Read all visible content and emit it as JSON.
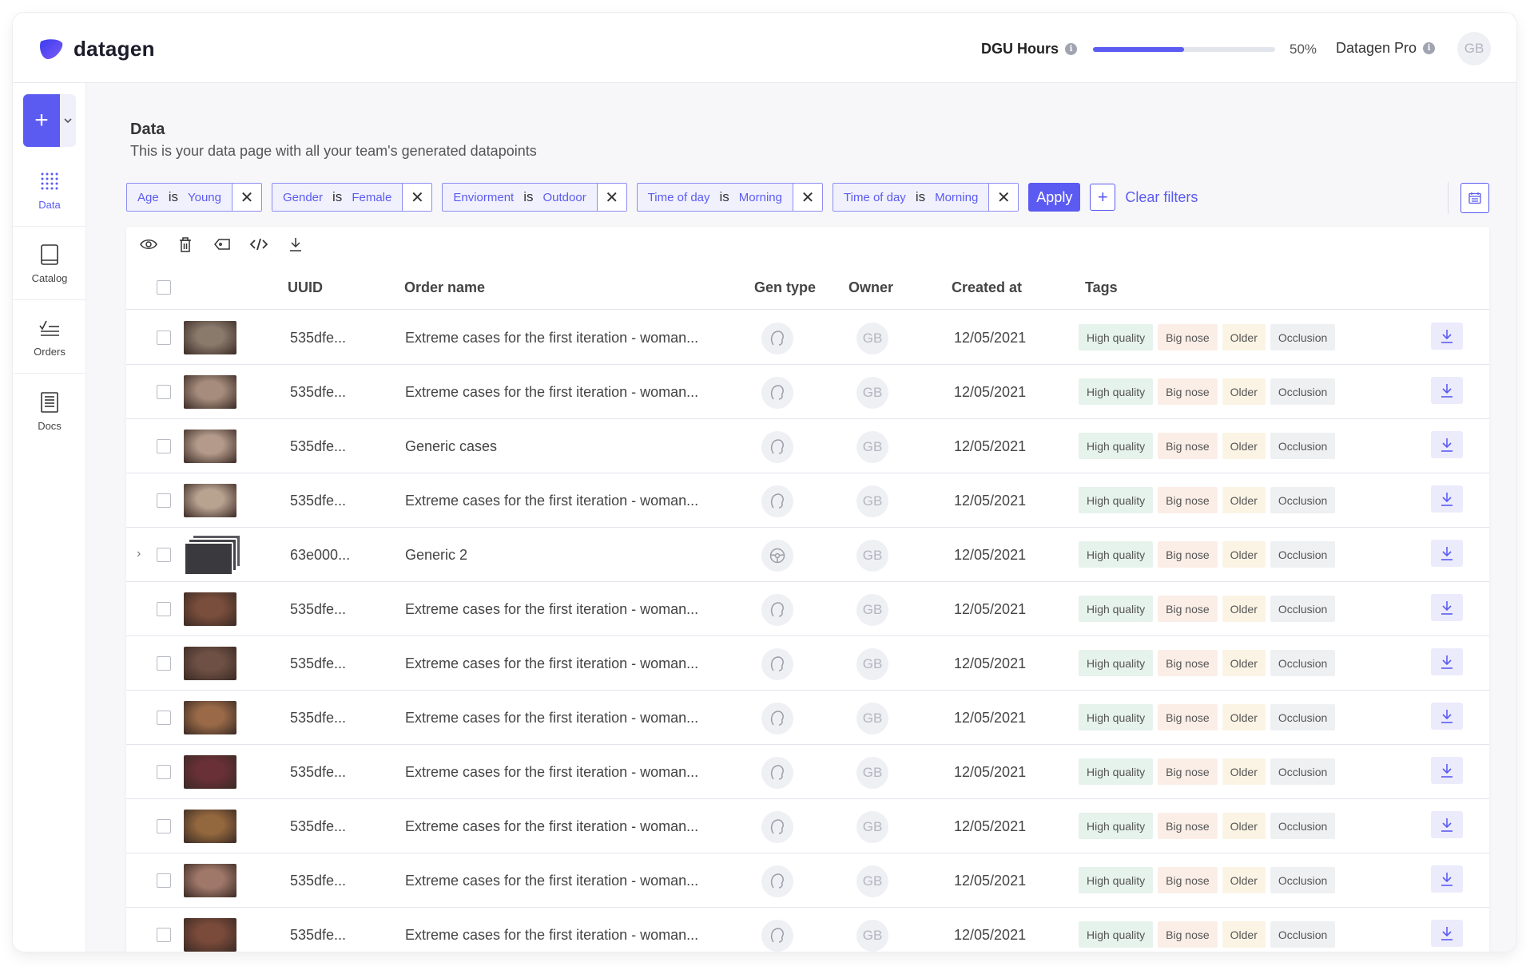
{
  "header": {
    "logo_text": "datagen",
    "dgu_label": "DGU Hours",
    "dgu_progress": 0.5,
    "dgu_percent": "50%",
    "plan_label": "Datagen Pro",
    "user_initials": "GB",
    "accent_color": "#5b5bf2"
  },
  "sidebar": {
    "new_button_icon": "plus-icon",
    "items": [
      {
        "label": "Data",
        "icon": "grid-dots-icon",
        "active": true
      },
      {
        "label": "Catalog",
        "icon": "book-icon",
        "active": false
      },
      {
        "label": "Orders",
        "icon": "checklist-icon",
        "active": false
      },
      {
        "label": "Docs",
        "icon": "document-icon",
        "active": false
      }
    ]
  },
  "page": {
    "title": "Data",
    "subtitle": "This is your data page with all your team's generated datapoints"
  },
  "filters": {
    "chips": [
      {
        "field": "Age",
        "op": "is",
        "value": "Young"
      },
      {
        "field": "Gender",
        "op": "is",
        "value": "Female"
      },
      {
        "field": "Enviorment",
        "op": "is",
        "value": "Outdoor"
      },
      {
        "field": "Time of day",
        "op": "is",
        "value": "Morning"
      },
      {
        "field": "Time of day",
        "op": "is",
        "value": "Morning"
      }
    ],
    "apply_label": "Apply",
    "add_label": "+",
    "clear_label": "Clear filters"
  },
  "table": {
    "columns": {
      "uuid": "UUID",
      "order_name": "Order name",
      "gen_type": "Gen type",
      "owner": "Owner",
      "created_at": "Created at",
      "tags": "Tags"
    },
    "rows": [
      {
        "uuid": "535dfe...",
        "order_name": "Extreme cases for the first iteration - woman...",
        "gen": "face",
        "owner": "GB",
        "created": "12/05/2021",
        "tags": [
          "High quality",
          "Big nose",
          "Older",
          "Occlusion"
        ],
        "thumb": "#8a7a6c",
        "expandable": false
      },
      {
        "uuid": "535dfe...",
        "order_name": "Extreme cases for the first iteration - woman...",
        "gen": "face",
        "owner": "GB",
        "created": "12/05/2021",
        "tags": [
          "High quality",
          "Big nose",
          "Older",
          "Occlusion"
        ],
        "thumb": "#a58c7c",
        "expandable": false
      },
      {
        "uuid": "535dfe...",
        "order_name": "Generic cases",
        "gen": "face",
        "owner": "GB",
        "created": "12/05/2021",
        "tags": [
          "High quality",
          "Big nose",
          "Older",
          "Occlusion"
        ],
        "thumb": "#b39a8a",
        "expandable": false
      },
      {
        "uuid": "535dfe...",
        "order_name": "Extreme cases for the first iteration - woman...",
        "gen": "face",
        "owner": "GB",
        "created": "12/05/2021",
        "tags": [
          "High quality",
          "Big nose",
          "Older",
          "Occlusion"
        ],
        "thumb": "#b8a290",
        "expandable": false
      },
      {
        "uuid": "63e000...",
        "order_name": "Generic 2",
        "gen": "wheel",
        "owner": "GB",
        "created": "12/05/2021",
        "tags": [
          "High quality",
          "Big nose",
          "Older",
          "Occlusion"
        ],
        "thumb": "#3a3a3e",
        "expandable": true
      },
      {
        "uuid": "535dfe...",
        "order_name": "Extreme cases for the first iteration - woman...",
        "gen": "face",
        "owner": "GB",
        "created": "12/05/2021",
        "tags": [
          "High quality",
          "Big nose",
          "Older",
          "Occlusion"
        ],
        "thumb": "#7a4e3c",
        "expandable": false
      },
      {
        "uuid": "535dfe...",
        "order_name": "Extreme cases for the first iteration - woman...",
        "gen": "face",
        "owner": "GB",
        "created": "12/05/2021",
        "tags": [
          "High quality",
          "Big nose",
          "Older",
          "Occlusion"
        ],
        "thumb": "#6e5044",
        "expandable": false
      },
      {
        "uuid": "535dfe...",
        "order_name": "Extreme cases for the first iteration - woman...",
        "gen": "face",
        "owner": "GB",
        "created": "12/05/2021",
        "tags": [
          "High quality",
          "Big nose",
          "Older",
          "Occlusion"
        ],
        "thumb": "#9a6a48",
        "expandable": false
      },
      {
        "uuid": "535dfe...",
        "order_name": "Extreme cases for the first iteration - woman...",
        "gen": "face",
        "owner": "GB",
        "created": "12/05/2021",
        "tags": [
          "High quality",
          "Big nose",
          "Older",
          "Occlusion"
        ],
        "thumb": "#6a3038",
        "expandable": false
      },
      {
        "uuid": "535dfe...",
        "order_name": "Extreme cases for the first iteration - woman...",
        "gen": "face",
        "owner": "GB",
        "created": "12/05/2021",
        "tags": [
          "High quality",
          "Big nose",
          "Older",
          "Occlusion"
        ],
        "thumb": "#94683e",
        "expandable": false
      },
      {
        "uuid": "535dfe...",
        "order_name": "Extreme cases for the first iteration - woman...",
        "gen": "face",
        "owner": "GB",
        "created": "12/05/2021",
        "tags": [
          "High quality",
          "Big nose",
          "Older",
          "Occlusion"
        ],
        "thumb": "#a0786a",
        "expandable": false
      },
      {
        "uuid": "535dfe...",
        "order_name": "Extreme cases for the first iteration - woman...",
        "gen": "face",
        "owner": "GB",
        "created": "12/05/2021",
        "tags": [
          "High quality",
          "Big nose",
          "Older",
          "Occlusion"
        ],
        "thumb": "#7a4a3a",
        "expandable": false
      }
    ]
  }
}
